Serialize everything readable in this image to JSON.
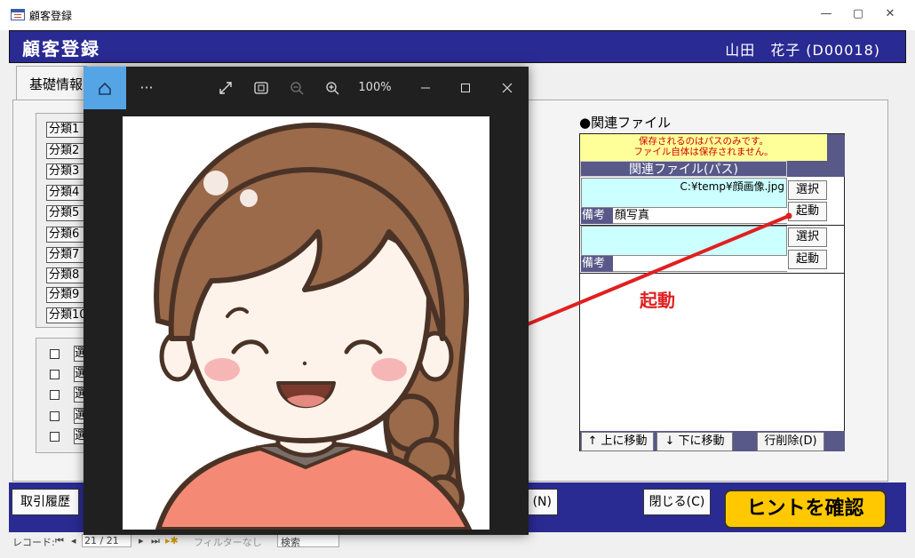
{
  "window": {
    "title": "顧客登録",
    "minimize": "—",
    "maximize": "▢",
    "close": "✕"
  },
  "header": {
    "form_title": "顧客登録",
    "customer": "山田　花子 (D00018)"
  },
  "tab": {
    "label": "基礎情報"
  },
  "categories": [
    "分類1",
    "分類2",
    "分類3",
    "分類4",
    "分類5",
    "分類6",
    "分類7",
    "分類8",
    "分類9",
    "分類10"
  ],
  "selections": {
    "label": "選"
  },
  "related": {
    "title": "●関連ファイル",
    "warning_line1": "保存されるのはパスのみです。",
    "warning_line2": "ファイル自体は保存されません。",
    "column_header": "関連ファイル(パス)",
    "rows": [
      {
        "path": "C:¥temp¥顔画像.jpg",
        "memo_label": "備考",
        "memo": "顔写真",
        "select_btn": "選択",
        "launch_btn": "起動"
      },
      {
        "path": "",
        "memo_label": "備考",
        "memo": "",
        "select_btn": "選択",
        "launch_btn": "起動"
      }
    ],
    "move_up": "↑ 上に移動",
    "move_down": "↓ 下に移動",
    "delete_row": "行削除(D)"
  },
  "annotation": "起動",
  "footer": {
    "history": "取引履歴",
    "hidden_btn": "(N)",
    "close": "閉じる(C)",
    "hint": "ヒントを確認"
  },
  "status": {
    "record_label": "レコード:",
    "record_pos": "21 / 21",
    "filter": "フィルターなし",
    "search": "検索"
  },
  "viewer": {
    "zoom": "100%",
    "more": "···"
  },
  "colors": {
    "header_bg": "#2a2a93",
    "accent_yellow": "#ffc800",
    "viewer_bg": "#202020",
    "viewer_home": "#55a5e6",
    "annotation_red": "#e02020"
  }
}
